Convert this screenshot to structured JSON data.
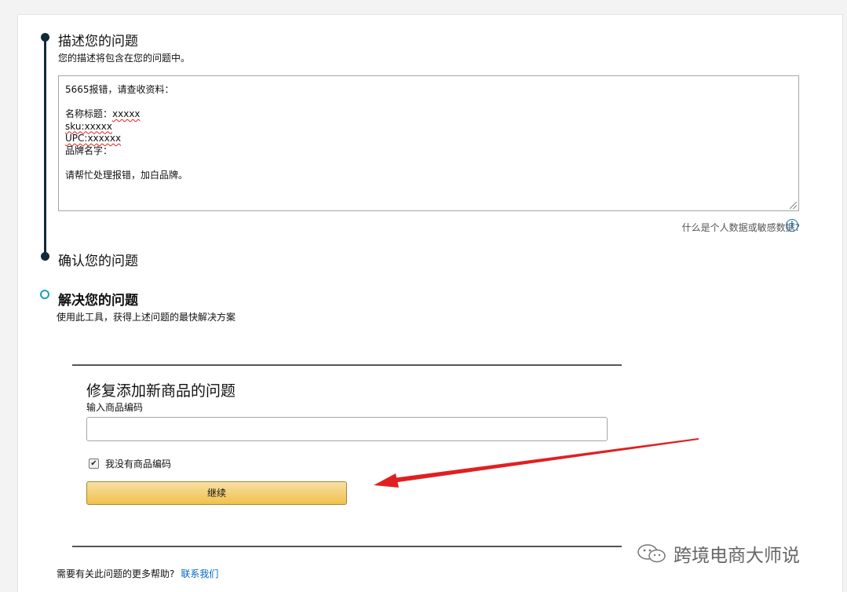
{
  "steps": {
    "describe": {
      "title": "描述您的问题",
      "subtitle": "您的描述将包含在您的问题中。"
    },
    "confirm": {
      "title": "确认您的问题"
    },
    "resolve": {
      "title": "解决您的问题",
      "subtitle": "使用此工具，获得上述问题的最快解决方案"
    }
  },
  "description": {
    "line1": "5665报错，请查收资料：",
    "line2_label": "名称标题：",
    "line2_value": "xxxxx",
    "line3": "sku:xxxxx",
    "line4": "UPC:xxxxxx",
    "line5": "品牌名字：",
    "line6": "请帮忙处理报错，加白品牌。"
  },
  "privacy_link": "什么是个人数据或敏感数据?",
  "info_icon_glyph": "i",
  "tool": {
    "title": "修复添加新商品的问题",
    "input_label": "输入商品编码",
    "input_value": "",
    "checkbox_label": "我没有商品编码",
    "checkbox_checked": true,
    "continue_label": "继续"
  },
  "help": {
    "text": "需要有关此问题的更多帮助?",
    "link": "联系我们"
  },
  "watermark": "跨境电商大师说",
  "colors": {
    "timeline": "#0f2a3a",
    "active_step": "#1aa1b5",
    "button": "#f0c14b",
    "link": "#0066c0",
    "annotation_arrow": "#e02020"
  }
}
